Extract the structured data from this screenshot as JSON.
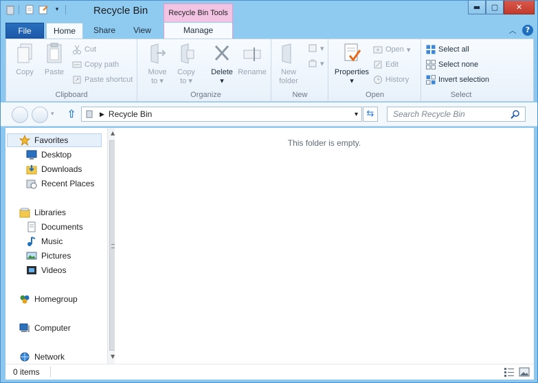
{
  "window": {
    "title": "Recycle Bin",
    "context_tab": "Recycle Bin Tools"
  },
  "window_buttons": {
    "minimize": "▬",
    "maximize": "▢",
    "close": "✕"
  },
  "ribbon_tabs": {
    "file": "File",
    "home": "Home",
    "share": "Share",
    "view": "View",
    "manage": "Manage"
  },
  "clipboard": {
    "label": "Clipboard",
    "copy": "Copy",
    "paste": "Paste",
    "cut": "Cut",
    "copy_path": "Copy path",
    "paste_shortcut": "Paste shortcut"
  },
  "organize": {
    "label": "Organize",
    "move_to": "Move",
    "move_to_2": "to",
    "copy_to": "Copy",
    "copy_to_2": "to",
    "delete": "Delete",
    "rename": "Rename"
  },
  "new": {
    "label": "New",
    "new_folder": "New",
    "new_folder_2": "folder"
  },
  "open": {
    "label": "Open",
    "properties": "Properties",
    "open": "Open",
    "edit": "Edit",
    "history": "History"
  },
  "select": {
    "label": "Select",
    "select_all": "Select all",
    "select_none": "Select none",
    "invert_selection": "Invert selection"
  },
  "address": {
    "path": "Recycle Bin",
    "search_placeholder": "Search Recycle Bin"
  },
  "nav": {
    "favorites": "Favorites",
    "desktop": "Desktop",
    "downloads": "Downloads",
    "recent_places": "Recent Places",
    "libraries": "Libraries",
    "documents": "Documents",
    "music": "Music",
    "pictures": "Pictures",
    "videos": "Videos",
    "homegroup": "Homegroup",
    "computer": "Computer",
    "network": "Network"
  },
  "content": {
    "empty_message": "This folder is empty."
  },
  "status": {
    "item_count": "0 items"
  },
  "colors": {
    "accent": "#1b58a8",
    "context_tab": "#f3c3e3",
    "close": "#c23b2e"
  }
}
